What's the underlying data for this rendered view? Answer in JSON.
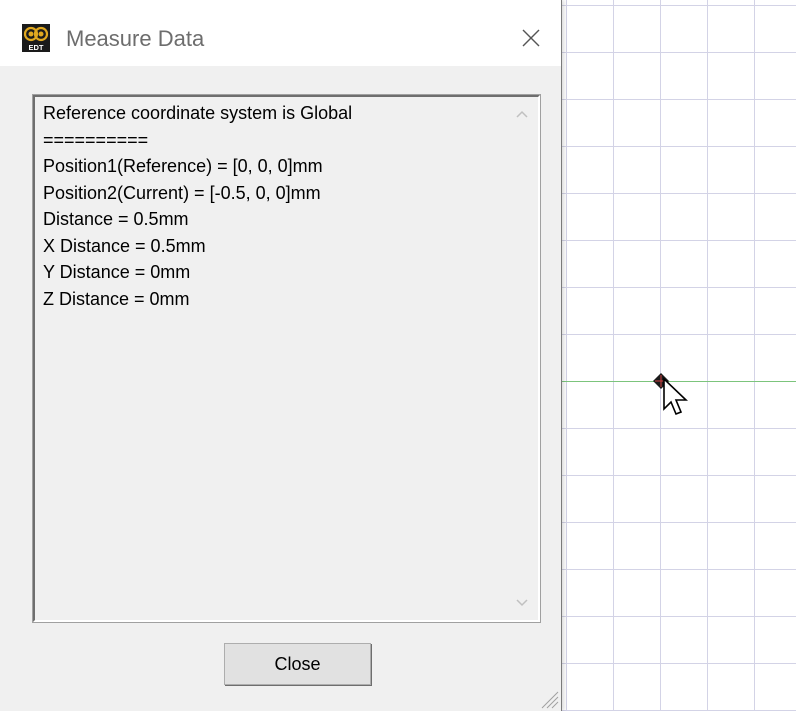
{
  "window": {
    "title": "Measure Data",
    "app_icon": "edt-app-icon",
    "close_icon": "close-icon"
  },
  "output": {
    "lines": [
      "Reference coordinate system is Global",
      "==========",
      "Position1(Reference) = [0, 0, 0]mm",
      "Position2(Current) = [-0.5, 0, 0]mm",
      "Distance = 0.5mm",
      "X Distance = 0.5mm",
      "Y Distance = 0mm",
      "Z Distance = 0mm"
    ]
  },
  "buttons": {
    "close_label": "Close"
  },
  "app_icon_text": "EDT",
  "colors": {
    "grid": "#d3d3e6",
    "axis": "#7cc47c",
    "button": "#e1e1e1",
    "dialog_bg": "#f0f0f0"
  }
}
